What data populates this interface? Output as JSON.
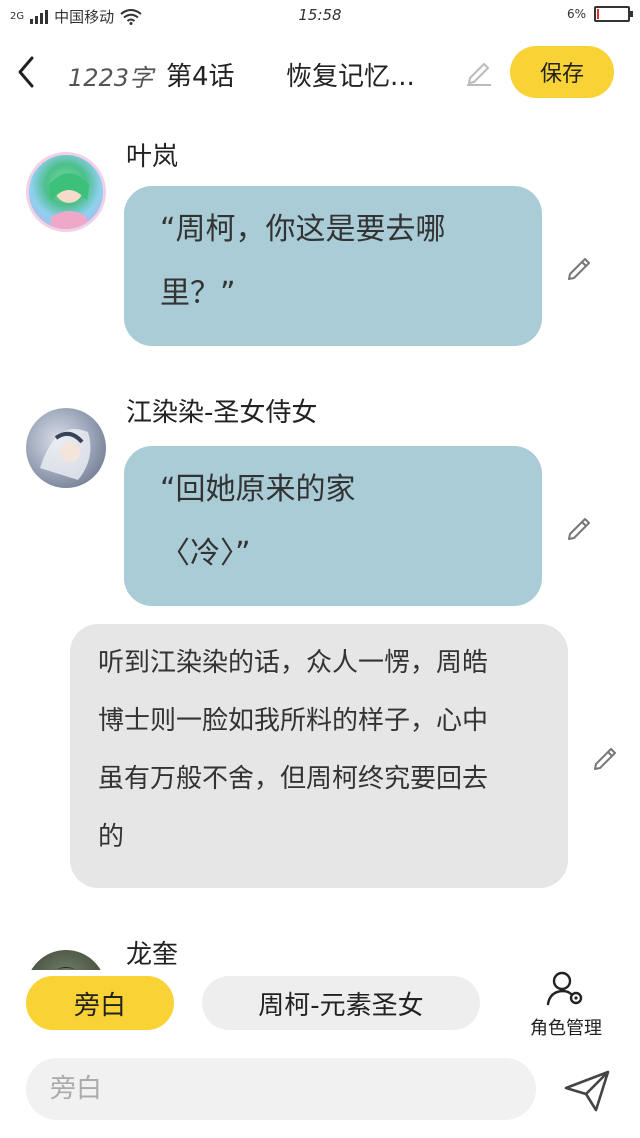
{
  "status": {
    "network": "2G",
    "carrier": "中国移动",
    "time": "15:58",
    "battery_text": "6%",
    "battery_level": 0.06
  },
  "header": {
    "word_count": "1223字",
    "chapter": "第4话",
    "title": "恢复记忆...",
    "save_label": "保存"
  },
  "messages": [
    {
      "type": "role",
      "name": "叶岚",
      "lines": [
        "“周柯，你这是要去哪",
        "里？”"
      ]
    },
    {
      "type": "role",
      "name": "江染染-圣女侍女",
      "lines": [
        "“回她原来的家",
        "〈冷〉”"
      ]
    },
    {
      "type": "narration",
      "lines": [
        "听到江染染的话，众人一愣，周皓",
        "博士则一脸如我所料的样子，心中",
        "虽有万般不舍，但周柯终究要回去",
        "的"
      ]
    },
    {
      "type": "role",
      "name": "龙奎",
      "lines": []
    }
  ],
  "roles": {
    "active": "旁白",
    "other": "周柯-元素圣女",
    "manage_label": "角色管理"
  },
  "composer": {
    "placeholder": "旁白"
  },
  "colors": {
    "accent": "#f9d236",
    "role_bubble": "#a9ccd6",
    "narration_bubble": "#e6e6e6"
  }
}
